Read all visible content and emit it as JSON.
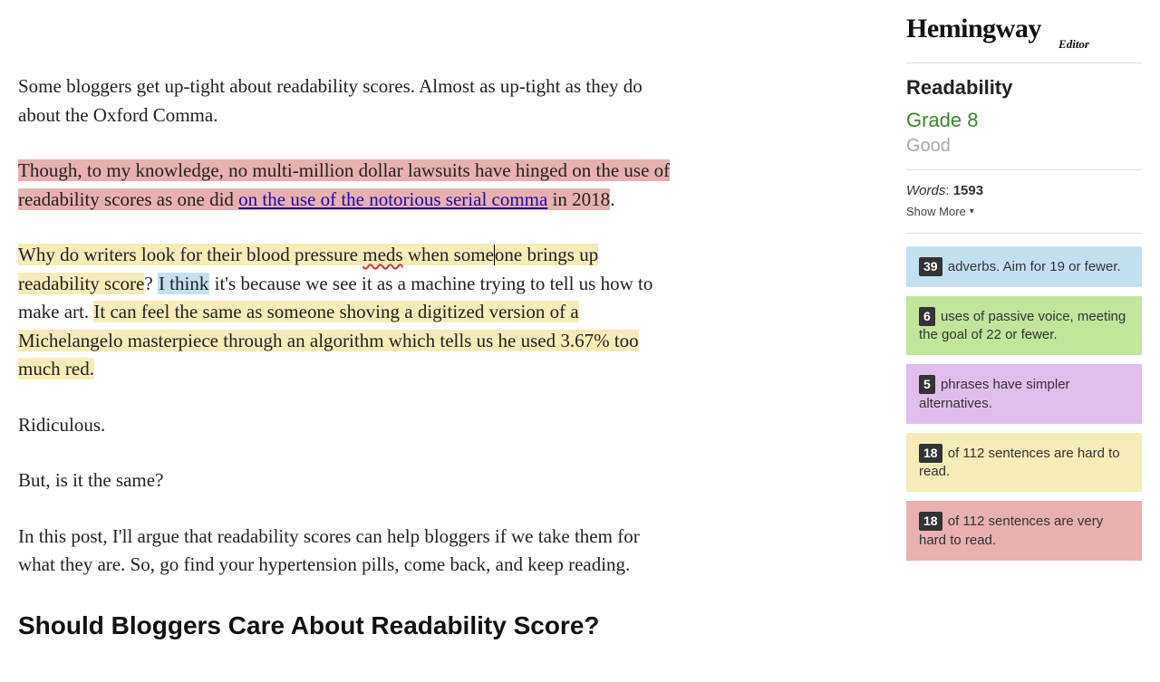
{
  "editor": {
    "p1": "Some bloggers get up-tight about readability scores. Almost as up-tight as they do about the Oxford Comma.",
    "p2_hl_a": "Though, to my knowledge, no multi-million dollar lawsuits have hinged on the use of readability scores as one did ",
    "p2_link": "on the use of the notorious serial comma",
    "p2_hl_b": " in 2018",
    "p2_after": ".",
    "p3_hl1_a": "Why do writers look for their blood pressure ",
    "p3_meds": "meds",
    "p3_hl1_b": " when some",
    "p3_hl1_c": "one brings up readability score",
    "p3_plain_a": "? ",
    "p3_qualifier": "I think",
    "p3_plain_b": " it's because we see it as a machine trying to tell us how to make art. ",
    "p3_hl2": "It can feel the same as someone shoving a digitized version of a Michelangelo masterpiece through an algorithm which tells us he used 3.67% too much red.",
    "p4": "Ridiculous.",
    "p5": "But, is it the same?",
    "p6": "In this post, I'll argue that readability scores can help bloggers if we take them for what they are. So, go find your hypertension pills, come back, and keep reading.",
    "h2": "Should Bloggers Care About Readability Score?"
  },
  "sidebar": {
    "logo_main": "Hemingway",
    "logo_sub": "Editor",
    "readability_title": "Readability",
    "grade": "Grade 8",
    "quality": "Good",
    "words_label": "Words",
    "words_count": "1593",
    "show_more": "Show More",
    "cards": {
      "adverbs": {
        "count": "39",
        "text": " adverbs. Aim for 19 or fewer."
      },
      "passive": {
        "count": "6",
        "text": " uses of passive voice, meeting the goal of 22 or fewer."
      },
      "complex": {
        "count": "5",
        "text": " phrases have simpler alternatives."
      },
      "hard": {
        "count": "18",
        "text": " of 112 sentences are hard to read."
      },
      "veryhard": {
        "count": "18",
        "text": " of 112 sentences are very hard to read."
      }
    }
  }
}
